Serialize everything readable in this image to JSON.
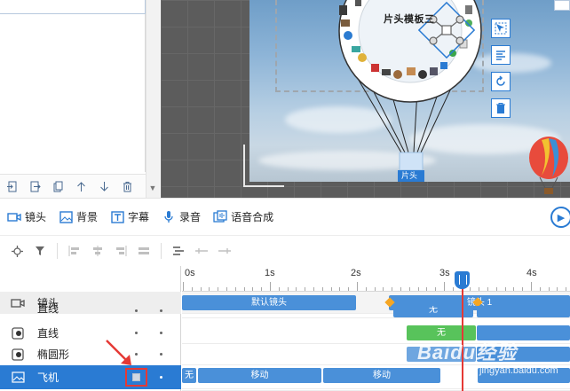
{
  "stage": {
    "title": "片头模板三",
    "basket_label": "片头"
  },
  "toolbar": {
    "items": [
      {
        "label": "镜头",
        "icon": "camera-icon"
      },
      {
        "label": "背景",
        "icon": "image-icon"
      },
      {
        "label": "字幕",
        "icon": "text-icon"
      },
      {
        "label": "录音",
        "icon": "microphone-icon"
      },
      {
        "label": "语音合成",
        "icon": "speech-synthesis-icon"
      }
    ],
    "play_icon": "▶"
  },
  "ruler": {
    "ticks": [
      "0s",
      "1s",
      "2s",
      "3s",
      "4s"
    ]
  },
  "tracks": {
    "header": {
      "label": "镜头"
    },
    "rows": [
      {
        "label": "直线"
      },
      {
        "label": "直线"
      },
      {
        "label": "椭圆形"
      },
      {
        "label": "飞机"
      }
    ]
  },
  "clips": {
    "default_camera": "默认镜头",
    "camera_1": "镜头 1",
    "none": "无",
    "move": "移动"
  },
  "watermark": {
    "text": "Baidu经验",
    "sub": "jingyan.baidu.com"
  },
  "colors": {
    "accent": "#2a7bd3",
    "playhead": "#e53935",
    "keyframe": "#f5a623",
    "clip_green": "#58c35b"
  }
}
